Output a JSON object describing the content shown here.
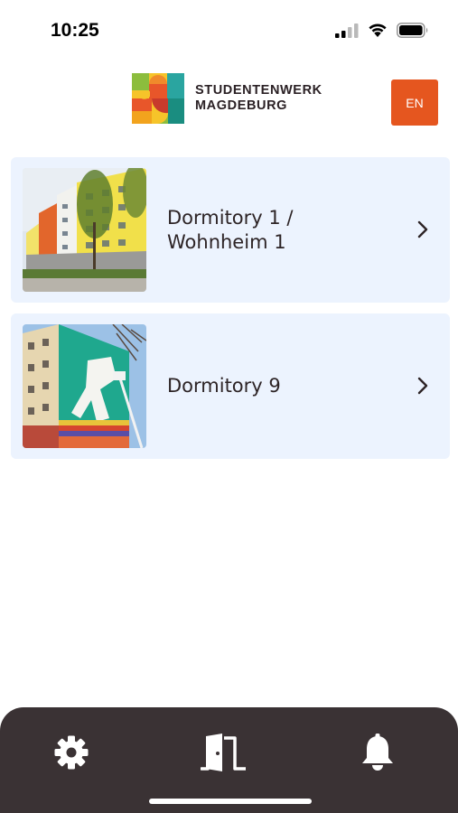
{
  "status_bar": {
    "time": "10:25"
  },
  "header": {
    "logo_line1": "STUDENTENWERK",
    "logo_line2": "MAGDEBURG",
    "language_button": "EN",
    "accent_color": "#e5561f"
  },
  "dormitories": [
    {
      "name": "Dormitory 1 /\nWohnheim 1",
      "photo_icon": "building-photo",
      "chevron_icon": "chevron-right-icon"
    },
    {
      "name": "Dormitory 9",
      "photo_icon": "building-mural-photo",
      "chevron_icon": "chevron-right-icon"
    }
  ],
  "tab_bar": {
    "background_color": "#3a3234",
    "tabs": [
      {
        "icon": "gear-icon",
        "name": "settings"
      },
      {
        "icon": "door-icon",
        "name": "dormitories",
        "selected": true
      },
      {
        "icon": "bell-icon",
        "name": "notifications"
      }
    ]
  }
}
